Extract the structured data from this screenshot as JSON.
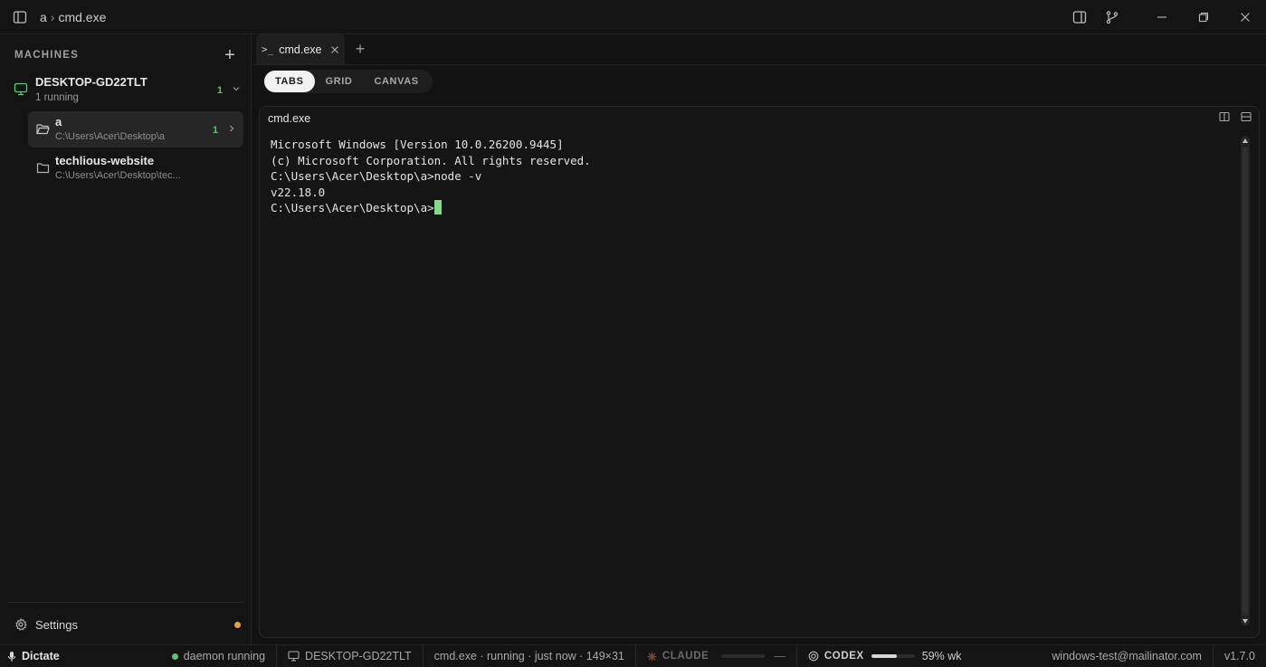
{
  "window": {
    "title_parts": [
      "a",
      "cmd.exe"
    ],
    "title_separator": "›"
  },
  "sidebar": {
    "section_label": "MACHINES",
    "add_label": "+",
    "machine": {
      "name": "DESKTOP-GD22TLT",
      "status": "1 running",
      "count": "1"
    },
    "folders": [
      {
        "name": "a",
        "path": "C:\\Users\\Acer\\Desktop\\a",
        "count": "1",
        "active": true
      },
      {
        "name": "techlious-website",
        "path": "C:\\Users\\Acer\\Desktop\\tec...",
        "count": "",
        "active": false
      }
    ],
    "settings_label": "Settings",
    "settings_badge_color": "#e6a73a"
  },
  "tabs": [
    {
      "prompt": ">_",
      "label": "cmd.exe",
      "active": true
    }
  ],
  "add_tab_label": "+",
  "view_modes": [
    {
      "label": "TABS",
      "active": true
    },
    {
      "label": "GRID",
      "active": false
    },
    {
      "label": "CANVAS",
      "active": false
    }
  ],
  "pane": {
    "title": "cmd.exe",
    "terminal_lines": [
      "Microsoft Windows [Version 10.0.26200.9445]",
      "(c) Microsoft Corporation. All rights reserved.",
      "",
      "C:\\Users\\Acer\\Desktop\\a>node -v",
      "v22.18.0",
      "",
      "C:\\Users\\Acer\\Desktop\\a>"
    ]
  },
  "statusbar": {
    "dictate": "Dictate",
    "daemon": "daemon running",
    "machine": "DESKTOP-GD22TLT",
    "session": "cmd.exe · running · just now · 149×31",
    "claude_label": "CLAUDE",
    "claude_value": "—",
    "claude_fraction": 0,
    "codex_label": "CODEX",
    "codex_fraction": 0.59,
    "codex_value": "59% wk",
    "account": "windows-test@mailinator.com",
    "version": "v1.7.0"
  },
  "colors": {
    "accent_green": "#5ec46e",
    "cursor": "#7fdc8a",
    "background": "#121212"
  }
}
